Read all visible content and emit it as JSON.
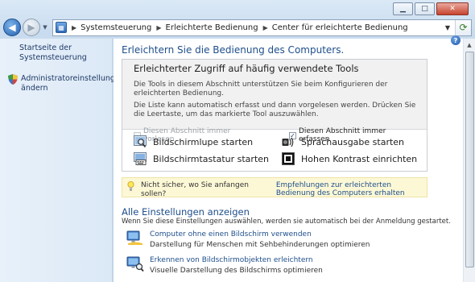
{
  "window": {
    "caption_minimize": "▁",
    "caption_maximize": "□",
    "caption_close": "✕"
  },
  "nav": {
    "back_icon": "◀",
    "forward_icon": "▶",
    "dropdown_icon": "▼",
    "breadcrumbs": [
      "Systemsteuerung",
      "Erleichterte Bedienung",
      "Center für erleichterte Bedienung"
    ],
    "breadcrumb_sep": "▶",
    "refresh_icon": "⟳"
  },
  "sidebar": {
    "home_link": "Startseite der Systemsteuerung",
    "admin_link": "Administratoreinstellungen ändern"
  },
  "main": {
    "heading": "Erleichtern Sie die Bedienung des Computers.",
    "help_icon": "?",
    "toolbox": {
      "title": "Erleichterter Zugriff auf häufig verwendete Tools",
      "desc1": "Die Tools in diesem Abschnitt unterstützen Sie beim Konfigurieren der erleichterten Bedienung.",
      "desc2": "Die Liste kann automatisch erfasst und dann vorgelesen werden. Drücken Sie die Leertaste, um das markierte Tool auszuwählen.",
      "check_read_label": "Diesen Abschnitt immer vorlesen",
      "check_read_checked": false,
      "check_scan_label": "Diesen Abschnitt immer erfassen",
      "check_scan_checked": true,
      "tools": {
        "magnifier": "Bildschirmlupe starten",
        "narrator": "Sprachausgabe starten",
        "keyboard": "Bildschirmtastatur starten",
        "contrast": "Hohen Kontrast einrichten"
      }
    },
    "tip": {
      "text": "Nicht sicher, wo Sie anfangen sollen?",
      "link": "Empfehlungen zur erleichterten Bedienung des Computers erhalten"
    },
    "all_settings": {
      "heading": "Alle Einstellungen anzeigen",
      "desc": "Wenn Sie diese Einstellungen auswählen, werden sie automatisch bei der Anmeldung gestartet.",
      "items": [
        {
          "link": "Computer ohne einen Bildschirm verwenden",
          "desc": "Darstellung für Menschen mit Sehbehinderungen optimieren"
        },
        {
          "link": "Erkennen von Bildschirmobjekten erleichtern",
          "desc": "Visuelle Darstellung des Bildschirms optimieren"
        }
      ]
    }
  },
  "scrollbar": {
    "up_icon": "▲"
  },
  "colors": {
    "link": "#1e4e8c",
    "heading": "#1e4e8c",
    "tip_bg": "#fcf8d6"
  }
}
